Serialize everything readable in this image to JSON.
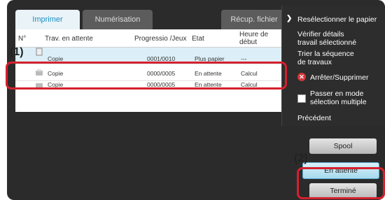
{
  "tabs": [
    {
      "label": "Imprimer"
    },
    {
      "label": "Numérisation"
    },
    {
      "label": "Récup. fichier"
    }
  ],
  "columns": {
    "trav": "Trav. en attente",
    "progress": "Progressio /Jeux",
    "etat": "Etat",
    "heure_line1": "Heure de",
    "heure_line2": "début"
  },
  "rows": [
    {
      "name": "Copie",
      "progress": "0001/0010",
      "etat": "Plus papier",
      "heure": "---"
    },
    {
      "name": "Copie",
      "progress": "0000/0005",
      "etat": "En attente",
      "heure": "Calcul"
    },
    {
      "name": "Copie",
      "progress": "0000/0005",
      "etat": "En attente",
      "heure": "Calcul"
    }
  ],
  "menu": {
    "reselect_paper": "Resélectionner le papier",
    "details_line1": "Vérifier détails",
    "details_line2": "travail sélectionné",
    "sort_line1": "Trier la séquence",
    "sort_line2": "de travaux",
    "stop": "Arrêter/Supprimer",
    "multi_line1": "Passer en mode",
    "multi_line2": "sélection multiple",
    "previous": "Précédent"
  },
  "buttons": {
    "spool": "Spool",
    "waiting": "En attente",
    "done": "Terminé"
  },
  "callouts": {
    "one": "(1)",
    "two": "(2)"
  },
  "colors": {
    "accent": "#1a8fc4",
    "highlight": "#d5202d",
    "stop_icon": "#d6353a"
  }
}
